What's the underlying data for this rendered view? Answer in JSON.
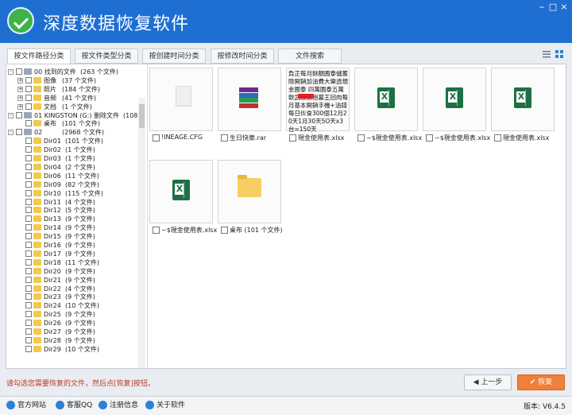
{
  "app": {
    "title": "深度数据恢复软件",
    "window_buttons": [
      "‒",
      "□",
      "×"
    ],
    "accent": "#1f6fd3"
  },
  "tabs": [
    {
      "label": "按文件路径分类"
    },
    {
      "label": "按文件类型分类"
    },
    {
      "label": "按创建时间分类"
    },
    {
      "label": "按修改时间分类"
    },
    {
      "label": "文件搜索"
    }
  ],
  "tree": {
    "root": [
      {
        "name": "00 找到的文件",
        "count": "(263 个文件)"
      },
      {
        "name": "图像",
        "count": "(37 个文件)"
      },
      {
        "name": "照片",
        "count": "(184 个文件)"
      },
      {
        "name": "音频",
        "count": "(41 个文件)"
      },
      {
        "name": "文档",
        "count": "(1 个文件)"
      },
      {
        "name": "01 KINGSTON (G:) 删除文件",
        "count": "(108 个"
      },
      {
        "name": "桌布",
        "count": "(101 个文件)"
      },
      {
        "name": "02",
        "count": "(2968 个文件)"
      }
    ],
    "dirs": [
      {
        "name": "Dir01",
        "count": "(101 个文件)"
      },
      {
        "name": "Dir02",
        "count": "(1 个文件)"
      },
      {
        "name": "Dir03",
        "count": "(1 个文件)"
      },
      {
        "name": "Dir04",
        "count": "(2 个文件)"
      },
      {
        "name": "Dir06",
        "count": "(11 个文件)"
      },
      {
        "name": "Dir09",
        "count": "(82 个文件)"
      },
      {
        "name": "Dir10",
        "count": "(115 个文件)"
      },
      {
        "name": "Dir11",
        "count": "(4 个文件)"
      },
      {
        "name": "Dir12",
        "count": "(5 个文件)"
      },
      {
        "name": "Dir13",
        "count": "(9 个文件)"
      },
      {
        "name": "Dir14",
        "count": "(9 个文件)"
      },
      {
        "name": "Dir15",
        "count": "(9 个文件)"
      },
      {
        "name": "Dir16",
        "count": "(9 个文件)"
      },
      {
        "name": "Dir17",
        "count": "(9 个文件)"
      },
      {
        "name": "Dir18",
        "count": "(11 个文件)"
      },
      {
        "name": "Dir20",
        "count": "(9 个文件)"
      },
      {
        "name": "Dir21",
        "count": "(9 个文件)"
      },
      {
        "name": "Dir22",
        "count": "(4 个文件)"
      },
      {
        "name": "Dir23",
        "count": "(9 个文件)"
      },
      {
        "name": "Dir24",
        "count": "(10 个文件)"
      },
      {
        "name": "Dir25",
        "count": "(9 个文件)"
      },
      {
        "name": "Dir26",
        "count": "(9 个文件)"
      },
      {
        "name": "Dir27",
        "count": "(9 个文件)"
      },
      {
        "name": "Dir28",
        "count": "(9 个文件)"
      },
      {
        "name": "Dir29",
        "count": "(10 个文件)"
      }
    ]
  },
  "files": [
    {
      "name": "!INEAGE.CFG",
      "type": "blank"
    },
    {
      "name": "生日快樂.rar",
      "type": "rar"
    },
    {
      "name": "現金使用表.xlsx",
      "type": "preview",
      "preview_text": "負正每月餘額圓泰儲蓄險開銷加油費大樂透現金圓泰 四萬圓泰五萬 軟武鼓鼓抱墓王回肉每月基本開銷手機+油錢每日伙食300個12月20天1月30天5O天x3台=150天"
    },
    {
      "name": "~$現金使用表.xlsx",
      "type": "xls"
    },
    {
      "name": "~$現金使用表.xlsx",
      "type": "xls"
    },
    {
      "name": "現金使用表.xlsx",
      "type": "xls"
    },
    {
      "name": "~$現金使用表.xlsx",
      "type": "xls"
    },
    {
      "name": "桌布  (101 个文件)",
      "type": "folder"
    }
  ],
  "hint": "请勾选您需要恢复的文件，然后点[恢复]按钮。",
  "buttons": {
    "prev": "上一步",
    "recover": "恢复"
  },
  "footer": {
    "links": [
      "官方网站",
      "客服QQ",
      "注册信息",
      "关于软件"
    ],
    "version": "版本: V6.4.5"
  }
}
